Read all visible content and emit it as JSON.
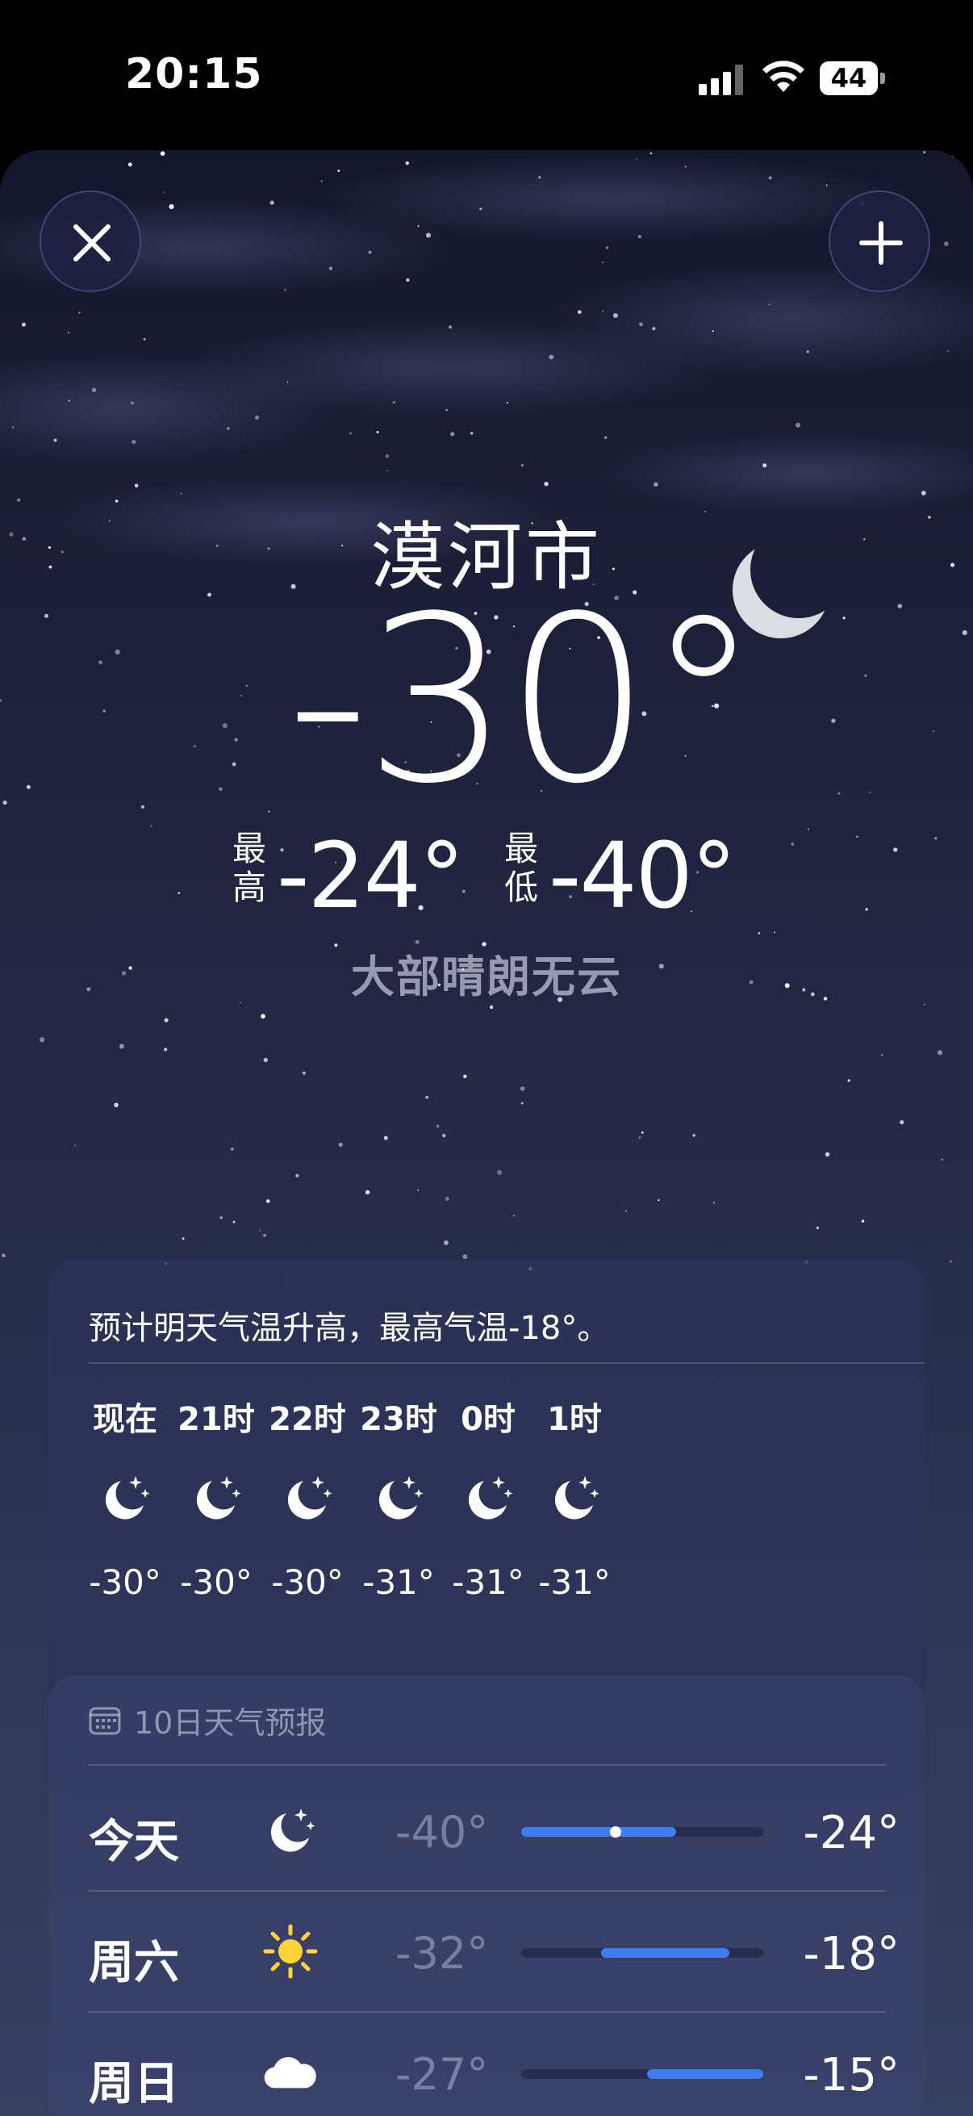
{
  "status_bar": {
    "time": "20:15",
    "battery": "44",
    "battery_percent": 44
  },
  "colors": {
    "accent_bar": "#3f7cf0",
    "sun": "#ffd43a"
  },
  "top_buttons": {
    "close_icon": "close-icon",
    "add_icon": "plus-icon"
  },
  "location": {
    "city": "漠河市",
    "temperature": "-30°",
    "high_label": "最高",
    "high": "-24°",
    "low_label": "最低",
    "low": "-40°",
    "condition": "大部晴朗无云"
  },
  "hourly": {
    "message": "预计明天气温升高，最高气温-18°。",
    "items": [
      {
        "label": "现在",
        "icon": "moon-stars-icon",
        "temp": "-30°"
      },
      {
        "label": "21时",
        "icon": "moon-stars-icon",
        "temp": "-30°"
      },
      {
        "label": "22时",
        "icon": "moon-stars-icon",
        "temp": "-30°"
      },
      {
        "label": "23时",
        "icon": "moon-stars-icon",
        "temp": "-31°"
      },
      {
        "label": "0时",
        "icon": "moon-stars-icon",
        "temp": "-31°"
      },
      {
        "label": "1时",
        "icon": "moon-stars-icon",
        "temp": "-31°"
      }
    ]
  },
  "forecast": {
    "header": "10日天气预报",
    "header_icon": "calendar-icon",
    "days": [
      {
        "day": "今天",
        "icon": "moon-stars-icon",
        "low": "-40°",
        "high": "-24°",
        "range_start": 0.0,
        "range_end": 0.64,
        "current_pos": 0.39
      },
      {
        "day": "周六",
        "icon": "sun-icon",
        "low": "-32°",
        "high": "-18°",
        "range_start": 0.33,
        "range_end": 0.86
      },
      {
        "day": "周日",
        "icon": "cloud-icon",
        "low": "-27°",
        "high": "-15°",
        "range_start": 0.52,
        "range_end": 1.0
      }
    ]
  }
}
